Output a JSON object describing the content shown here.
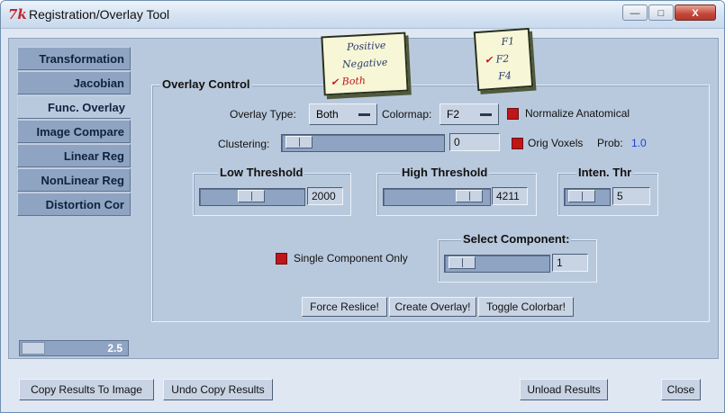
{
  "window": {
    "app_icon": "7k",
    "title": "Registration/Overlay Tool",
    "minimize_label": "—",
    "maximize_label": "□",
    "close_label": "X"
  },
  "sidebar": {
    "items": [
      {
        "label": "Transformation"
      },
      {
        "label": "Jacobian"
      },
      {
        "label": "Func. Overlay"
      },
      {
        "label": "Image Compare"
      },
      {
        "label": "Linear Reg"
      },
      {
        "label": "NonLinear Reg"
      },
      {
        "label": "Distortion Cor"
      }
    ],
    "active_index": 2,
    "zoom_value": "2.5"
  },
  "overlay_control": {
    "title": "Overlay Control",
    "overlay_type_label": "Overlay Type:",
    "overlay_type_value": "Both",
    "colormap_label": "Colormap:",
    "colormap_value": "F2",
    "normalize_label": "Normalize Anatomical",
    "clustering_label": "Clustering:",
    "clustering_value": "0",
    "orig_voxels_label": "Orig Voxels",
    "prob_label": "Prob:",
    "prob_value": "1.0",
    "low_threshold": {
      "title": "Low Threshold",
      "value": "2000"
    },
    "high_threshold": {
      "title": "High Threshold",
      "value": "4211"
    },
    "inten_thr": {
      "title": "Inten. Thr",
      "value": "5"
    },
    "single_component_label": "Single Component Only",
    "select_component": {
      "title": "Select Component:",
      "value": "1"
    },
    "buttons": {
      "force_reslice": "Force Reslice!",
      "create_overlay": "Create Overlay!",
      "toggle_colorbar": "Toggle Colorbar!"
    }
  },
  "overlay_type_menu": {
    "options": [
      "Positive",
      "Negative",
      "Both"
    ],
    "selected": "Both",
    "check_mark": "✔"
  },
  "colormap_menu": {
    "options": [
      "F1",
      "F2",
      "F4"
    ],
    "selected": "F2",
    "check_mark": "✔"
  },
  "bottom": {
    "copy_results": "Copy Results To Image",
    "undo_copy": "Undo Copy Results",
    "unload_results": "Unload Results",
    "close": "Close"
  },
  "colors": {
    "accent_red": "#c0151b",
    "panel_bg": "#b9c9dd",
    "prob_value_color": "#1b3fd6"
  }
}
